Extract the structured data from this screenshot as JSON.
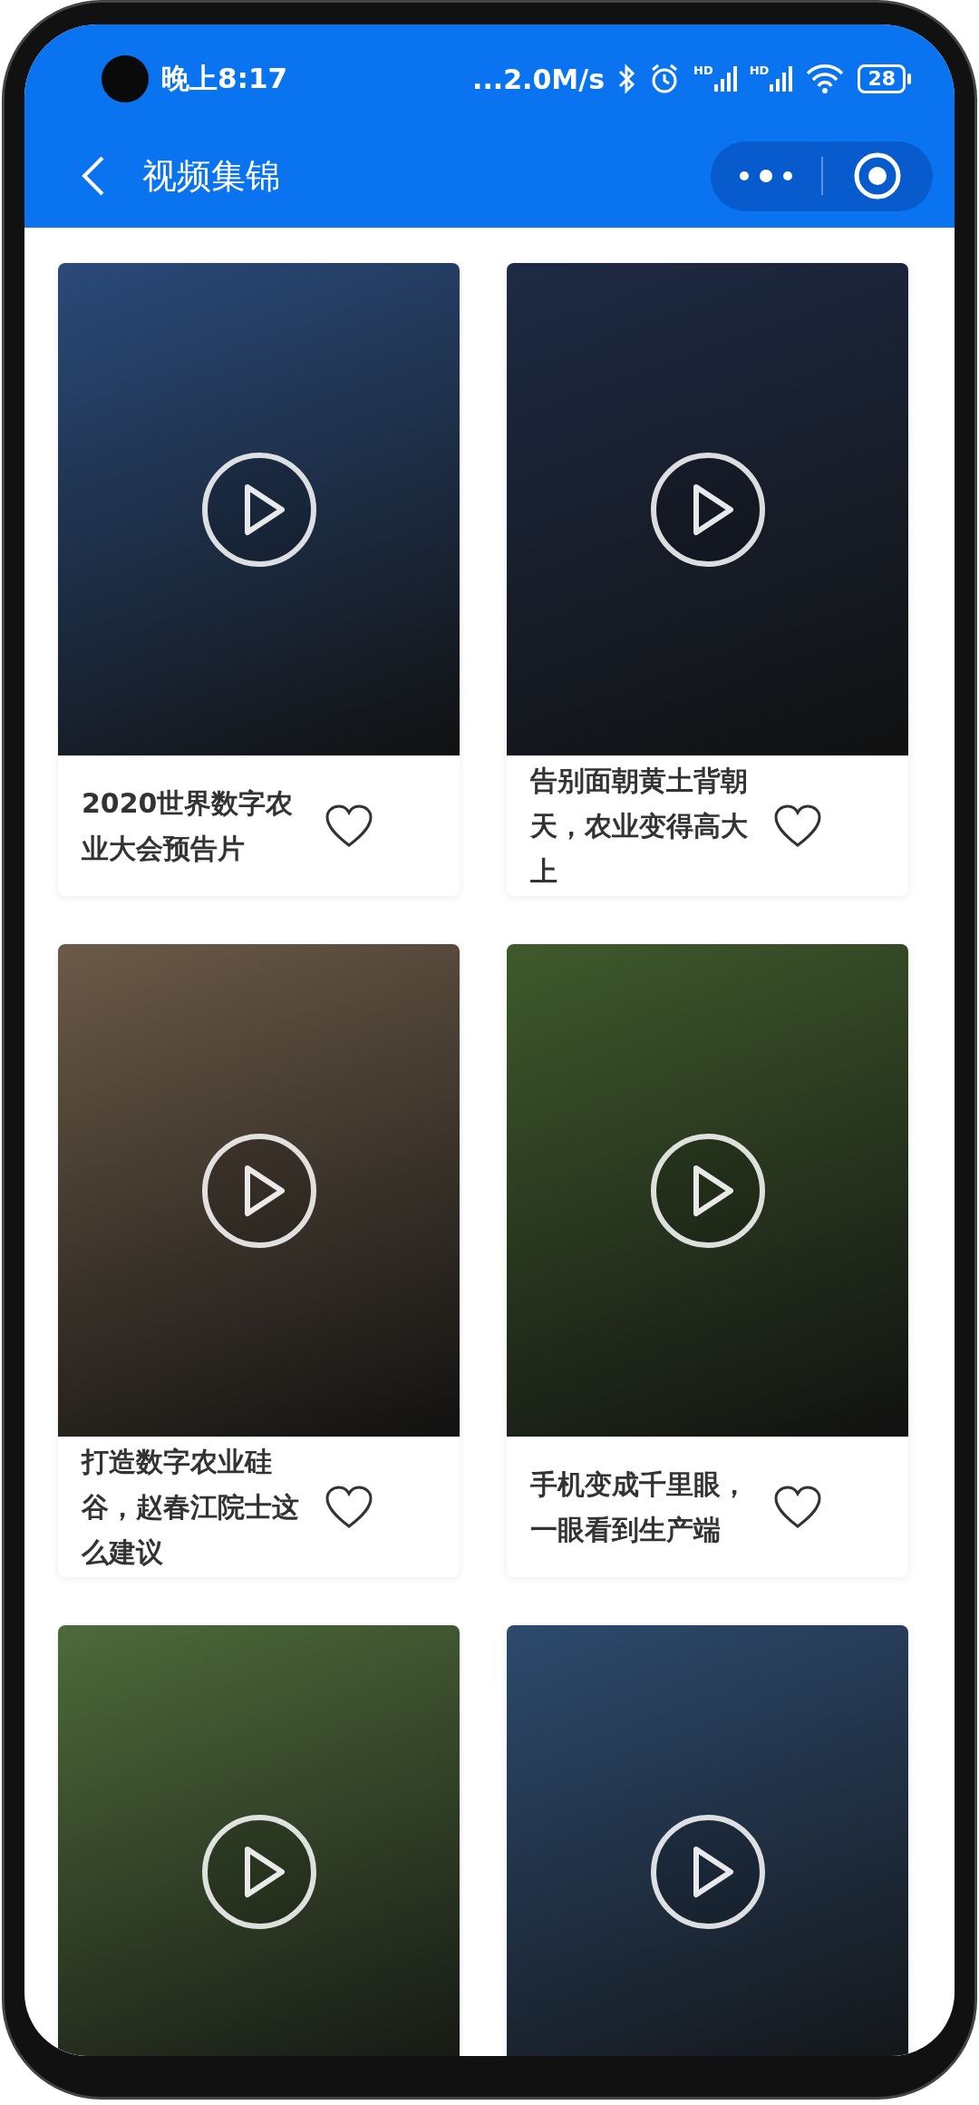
{
  "status_bar": {
    "time": "晚上8:17",
    "network_speed": "...2.0M/s",
    "signals": [
      {
        "label": "HD"
      },
      {
        "label": "HD"
      }
    ],
    "battery": "28"
  },
  "nav_bar": {
    "title": "视频集锦"
  },
  "videos": [
    {
      "kind": "card",
      "title": "2020世界数字农业大会预告片",
      "liked": false
    },
    {
      "kind": "card",
      "title": "告别面朝黄土背朝天，农业变得高大上",
      "liked": false
    },
    {
      "kind": "card",
      "title": "打造数字农业硅谷，赵春江院士这么建议",
      "liked": false
    },
    {
      "kind": "card",
      "title": "手机变成千里眼，一眼看到生产端",
      "liked": false
    },
    {
      "kind": "thumbnail"
    },
    {
      "kind": "thumbnail"
    }
  ]
}
